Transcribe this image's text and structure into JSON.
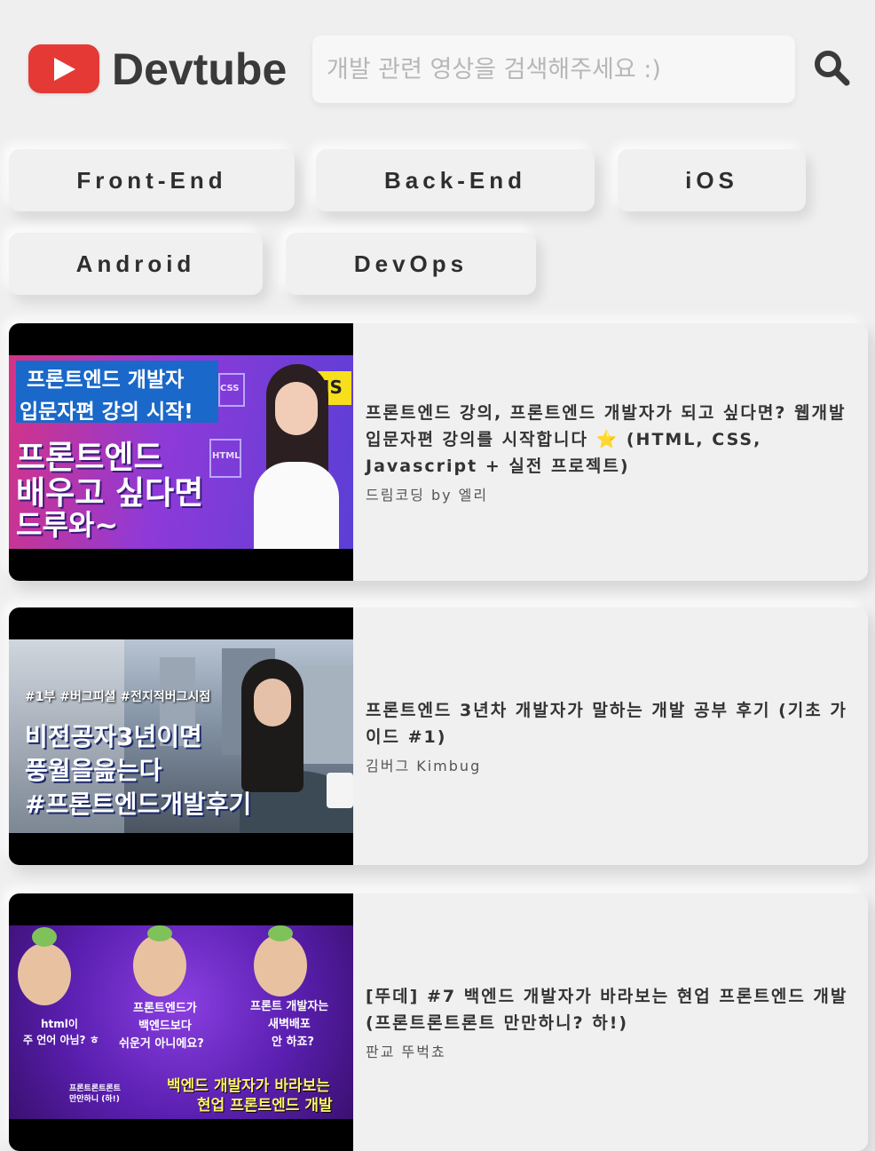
{
  "header": {
    "brand": "Devtube",
    "search_placeholder": "개발 관련 영상을 검색해주세요 :)",
    "search_value": ""
  },
  "categories": [
    "Front-End",
    "Back-End",
    "iOS",
    "Android",
    "DevOps"
  ],
  "videos": [
    {
      "title": "프론트엔드 강의, 프론트엔드 개발자가 되고 싶다면? 웹개발 입문자편 강의를 시작합니다 ⭐ (HTML, CSS, Javascript + 실전 프로젝트)",
      "channel": "드림코딩 by 엘리",
      "thumb_text": [
        "프론트엔드 개발자",
        "입문자편 강의 시작!",
        "프론트엔드",
        "배우고 싶다면",
        "드루와~",
        "JS",
        "CSS",
        "HTML"
      ]
    },
    {
      "title": "프론트엔드 3년차 개발자가 말하는 개발 공부 후기 (기초 가이드 #1)",
      "channel": "김버그 Kimbug",
      "thumb_text": [
        "#1부 #버그피셜 #전지적버그시점",
        "비전공자3년이면",
        "풍월을읊는다",
        "#프론트엔드개발후기"
      ]
    },
    {
      "title": "[뚜데] #7 백엔드 개발자가 바라보는 현업 프론트엔드 개발 (프론트론트론트 만만하니? 하!)",
      "channel": "판교 뚜벅쵸",
      "thumb_text": [
        "html이",
        "주 언어 아님? ㅎ",
        "프론트엔드가",
        "백엔드보다",
        "쉬운거 아니에요?",
        "프론트 개발자는",
        "새벽배포",
        "안 하죠?",
        "프론트론트론트",
        "만만하니 (하!)",
        "백엔드 개발자가 바라보는",
        "현업 프론트엔드 개발"
      ]
    }
  ],
  "colors": {
    "accent": "#e53935",
    "background": "#efefef"
  }
}
